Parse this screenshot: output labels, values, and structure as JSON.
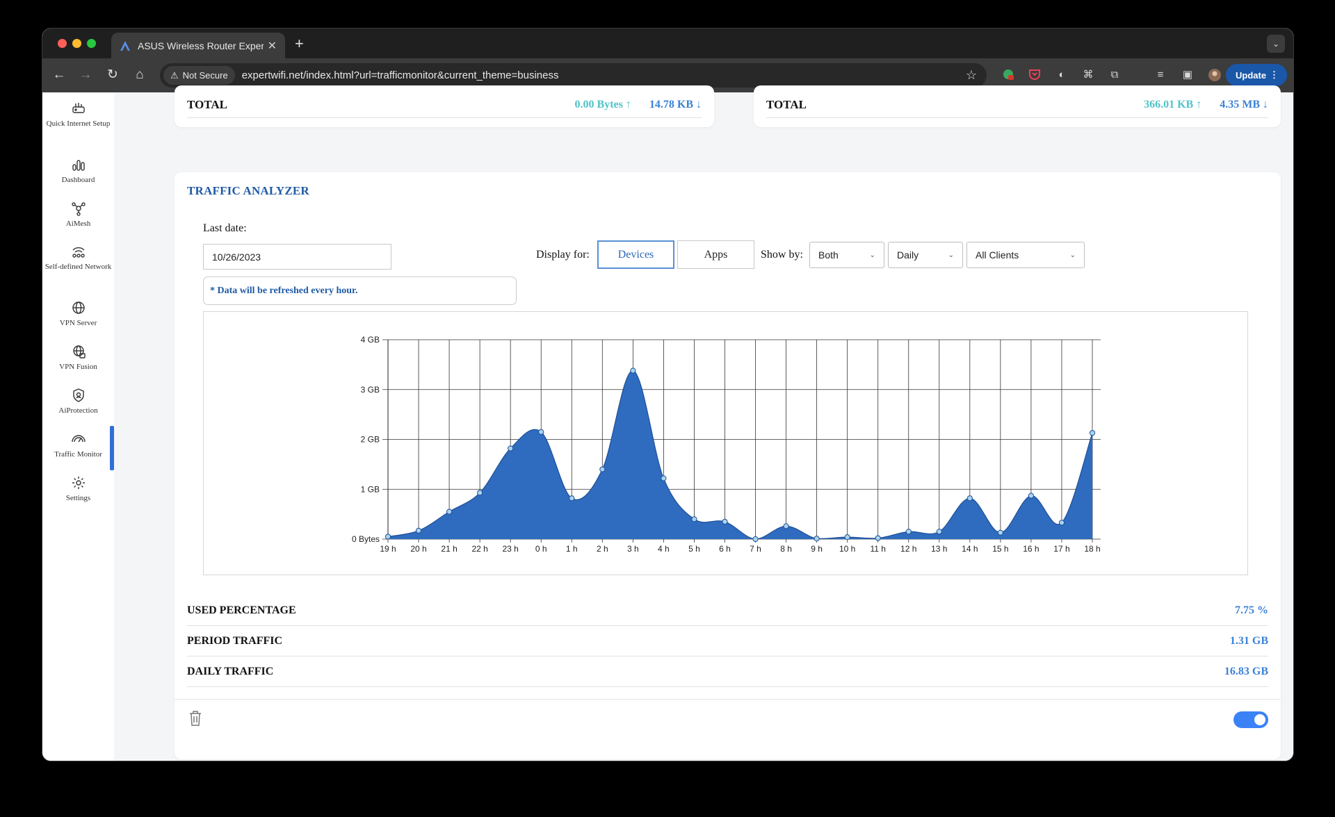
{
  "browser": {
    "tab_title": "ASUS Wireless Router Expert",
    "security_label": "Not Secure",
    "url": "expertwifi.net/index.html?url=trafficmonitor&current_theme=business",
    "update_label": "Update"
  },
  "sidebar": {
    "items": [
      {
        "label": "Quick Internet Setup",
        "icon": "router-setup-icon"
      },
      {
        "label": "Dashboard",
        "icon": "bar-chart-icon"
      },
      {
        "label": "AiMesh",
        "icon": "mesh-icon"
      },
      {
        "label": "Self-defined Network",
        "icon": "network-icon"
      },
      {
        "label": "VPN Server",
        "icon": "globe-icon"
      },
      {
        "label": "VPN Fusion",
        "icon": "globe-lock-icon"
      },
      {
        "label": "AiProtection",
        "icon": "shield-icon"
      },
      {
        "label": "Traffic Monitor",
        "icon": "speedometer-icon"
      },
      {
        "label": "Settings",
        "icon": "gear-icon"
      }
    ],
    "active": "Traffic Monitor"
  },
  "totals": {
    "left": {
      "label": "TOTAL",
      "up": "0.00 Bytes",
      "down": "14.78 KB"
    },
    "right": {
      "label": "TOTAL",
      "up": "366.01 KB",
      "down": "4.35 MB"
    }
  },
  "analyzer": {
    "title": "TRAFFIC ANALYZER",
    "last_date_label": "Last date:",
    "last_date_value": "10/26/2023",
    "notice": "* Data will be refreshed every hour.",
    "display_for_label": "Display for:",
    "display_devices": "Devices",
    "display_apps": "Apps",
    "show_by_label": "Show by:",
    "select_direction": "Both",
    "select_period": "Daily",
    "select_clients": "All Clients"
  },
  "chart_data": {
    "type": "area",
    "x": [
      "19 h",
      "20 h",
      "21 h",
      "22 h",
      "23 h",
      "0 h",
      "1 h",
      "2 h",
      "3 h",
      "4 h",
      "5 h",
      "6 h",
      "7 h",
      "8 h",
      "9 h",
      "10 h",
      "11 h",
      "12 h",
      "13 h",
      "14 h",
      "15 h",
      "16 h",
      "17 h",
      "18 h"
    ],
    "values_gb": [
      0.05,
      0.17,
      0.55,
      0.93,
      1.82,
      2.15,
      0.82,
      1.4,
      3.38,
      1.22,
      0.4,
      0.35,
      0.0,
      0.26,
      0.01,
      0.04,
      0.02,
      0.15,
      0.15,
      0.82,
      0.13,
      0.87,
      0.33,
      2.13
    ],
    "yticks": [
      "0 Bytes",
      "1 GB",
      "2 GB",
      "3 GB",
      "4 GB"
    ],
    "ylim": [
      0,
      4
    ],
    "grid": true,
    "colors": {
      "fill": "#2f6cbf",
      "line": "#1f4f96",
      "point": "#a9d3f0"
    }
  },
  "stats": [
    {
      "label": "USED PERCENTAGE",
      "value": "7.75 %"
    },
    {
      "label": "PERIOD TRAFFIC",
      "value": "1.31 GB"
    },
    {
      "label": "DAILY TRAFFIC",
      "value": "16.83 GB"
    }
  ]
}
